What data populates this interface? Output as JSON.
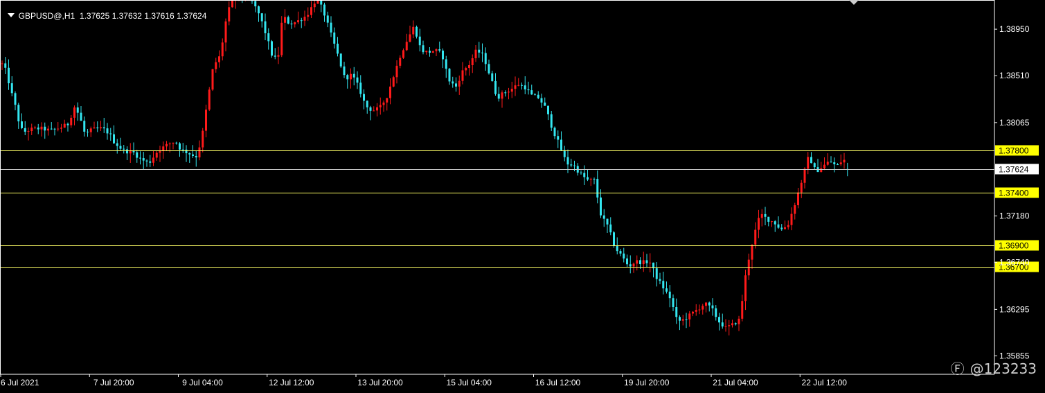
{
  "header": {
    "symbol_text": "GBPUSD@,H1",
    "ohlc_text": "1.37625 1.37632 1.37616 1.37624"
  },
  "watermark": {
    "text": "@123233",
    "icon": "weibo-icon"
  },
  "colors": {
    "background": "#000000",
    "bull": "#ff1a1a",
    "bear": "#33e6f0",
    "level_line": "#ffff66",
    "level_label_bg": "#ffff00",
    "price_label_bg": "#ffffff",
    "axis": "#ffffff"
  },
  "chart_data": {
    "type": "candlestick",
    "symbol": "GBPUSD@",
    "timeframe": "H1",
    "last": {
      "open": 1.37625,
      "high": 1.37632,
      "low": 1.37616,
      "close": 1.37624
    },
    "ylim": [
      1.3568,
      1.3922
    ],
    "y_ticks": [
      1.3895,
      1.3851,
      1.38065,
      1.3718,
      1.3674,
      1.36295,
      1.35855
    ],
    "x_ticks": [
      "6 Jul 2021",
      "7 Jul 20:00",
      "9 Jul 04:00",
      "12 Jul 12:00",
      "13 Jul 20:00",
      "15 Jul 04:00",
      "16 Jul 12:00",
      "19 Jul 20:00",
      "21 Jul 04:00",
      "22 Jul 12:00"
    ],
    "horizontal_levels": [
      1.378,
      1.374,
      1.369,
      1.367
    ],
    "current_price": 1.37624,
    "price_path": [
      [
        0,
        1.3862
      ],
      [
        6,
        1.3855
      ],
      [
        12,
        1.3838
      ],
      [
        18,
        1.3825
      ],
      [
        24,
        1.3808
      ],
      [
        30,
        1.3797
      ],
      [
        40,
        1.38
      ],
      [
        55,
        1.3801
      ],
      [
        70,
        1.3799
      ],
      [
        85,
        1.3802
      ],
      [
        95,
        1.3805
      ],
      [
        105,
        1.3822
      ],
      [
        112,
        1.3812
      ],
      [
        120,
        1.3795
      ],
      [
        130,
        1.38
      ],
      [
        145,
        1.3801
      ],
      [
        155,
        1.3796
      ],
      [
        162,
        1.3788
      ],
      [
        175,
        1.378
      ],
      [
        190,
        1.3778
      ],
      [
        200,
        1.3772
      ],
      [
        212,
        1.3768
      ],
      [
        225,
        1.378
      ],
      [
        240,
        1.3786
      ],
      [
        250,
        1.3789
      ],
      [
        258,
        1.3781
      ],
      [
        268,
        1.3778
      ],
      [
        280,
        1.3774
      ],
      [
        288,
        1.379
      ],
      [
        295,
        1.382
      ],
      [
        305,
        1.386
      ],
      [
        315,
        1.387
      ],
      [
        325,
        1.391
      ],
      [
        335,
        1.3925
      ],
      [
        345,
        1.3928
      ],
      [
        352,
        1.393
      ],
      [
        362,
        1.392
      ],
      [
        372,
        1.3908
      ],
      [
        382,
        1.3888
      ],
      [
        390,
        1.387
      ],
      [
        398,
        1.3865
      ],
      [
        405,
        1.3908
      ],
      [
        415,
        1.39
      ],
      [
        425,
        1.3902
      ],
      [
        440,
        1.3908
      ],
      [
        455,
        1.3925
      ],
      [
        465,
        1.391
      ],
      [
        475,
        1.389
      ],
      [
        485,
        1.387
      ],
      [
        495,
        1.3848
      ],
      [
        505,
        1.3852
      ],
      [
        515,
        1.384
      ],
      [
        525,
        1.3822
      ],
      [
        535,
        1.3818
      ],
      [
        545,
        1.382
      ],
      [
        555,
        1.383
      ],
      [
        565,
        1.385
      ],
      [
        575,
        1.387
      ],
      [
        585,
        1.3885
      ],
      [
        595,
        1.3898
      ],
      [
        605,
        1.3875
      ],
      [
        615,
        1.3873
      ],
      [
        625,
        1.3875
      ],
      [
        635,
        1.3872
      ],
      [
        645,
        1.3847
      ],
      [
        655,
        1.384
      ],
      [
        665,
        1.3855
      ],
      [
        675,
        1.3862
      ],
      [
        685,
        1.3875
      ],
      [
        695,
        1.387
      ],
      [
        705,
        1.385
      ],
      [
        715,
        1.383
      ],
      [
        725,
        1.3835
      ],
      [
        735,
        1.3838
      ],
      [
        745,
        1.3843
      ],
      [
        755,
        1.384
      ],
      [
        765,
        1.3832
      ],
      [
        775,
        1.383
      ],
      [
        785,
        1.382
      ],
      [
        795,
        1.38
      ],
      [
        805,
        1.3785
      ],
      [
        815,
        1.3768
      ],
      [
        825,
        1.3766
      ],
      [
        835,
        1.3758
      ],
      [
        845,
        1.3752
      ],
      [
        855,
        1.3752
      ],
      [
        865,
        1.3718
      ],
      [
        875,
        1.3708
      ],
      [
        885,
        1.3688
      ],
      [
        895,
        1.368
      ],
      [
        905,
        1.367
      ],
      [
        915,
        1.3675
      ],
      [
        925,
        1.3674
      ],
      [
        935,
        1.3675
      ],
      [
        945,
        1.366
      ],
      [
        955,
        1.365
      ],
      [
        965,
        1.364
      ],
      [
        975,
        1.3618
      ],
      [
        985,
        1.362
      ],
      [
        995,
        1.3625
      ],
      [
        1005,
        1.363
      ],
      [
        1015,
        1.3635
      ],
      [
        1025,
        1.363
      ],
      [
        1035,
        1.3618
      ],
      [
        1045,
        1.3612
      ],
      [
        1055,
        1.3615
      ],
      [
        1065,
        1.362
      ],
      [
        1075,
        1.3668
      ],
      [
        1085,
        1.3698
      ],
      [
        1095,
        1.372
      ],
      [
        1105,
        1.3715
      ],
      [
        1115,
        1.3712
      ],
      [
        1125,
        1.3705
      ],
      [
        1135,
        1.371
      ],
      [
        1145,
        1.373
      ],
      [
        1155,
        1.3752
      ],
      [
        1165,
        1.3775
      ],
      [
        1175,
        1.376
      ],
      [
        1185,
        1.3765
      ],
      [
        1195,
        1.377
      ],
      [
        1205,
        1.3765
      ],
      [
        1215,
        1.3772
      ],
      [
        1224,
        1.37624
      ]
    ]
  }
}
